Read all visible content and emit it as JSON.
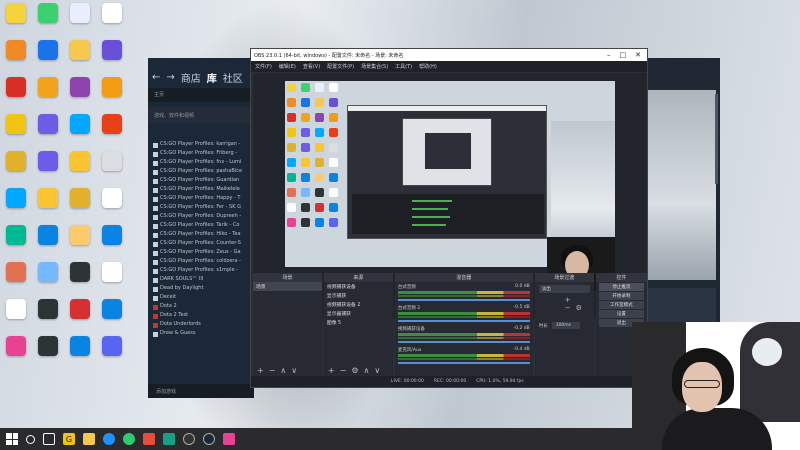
{
  "desktop_icons": [
    {
      "label": "",
      "color": "#f3d23b"
    },
    {
      "label": "",
      "color": "#3bd16f"
    },
    {
      "label": "",
      "color": "#e8f0ff"
    },
    {
      "label": "",
      "color": "#ffffff"
    },
    {
      "label": "",
      "color": "#f08a24"
    },
    {
      "label": "",
      "color": "#1a73e8"
    },
    {
      "label": "",
      "color": "#f6c94e"
    },
    {
      "label": "",
      "color": "#6a4fd8"
    },
    {
      "label": "",
      "color": "#d93025"
    },
    {
      "label": "",
      "color": "#f3a31b"
    },
    {
      "label": "",
      "color": "#8e44ad"
    },
    {
      "label": "",
      "color": "#f39c12"
    },
    {
      "label": "",
      "color": "#f1c40f"
    },
    {
      "label": "",
      "color": "#6c5ce7"
    },
    {
      "label": "",
      "color": "#00a8ff"
    },
    {
      "label": "",
      "color": "#e84118"
    },
    {
      "label": "",
      "color": "#e1b12c"
    },
    {
      "label": "",
      "color": "#6c5ce7"
    },
    {
      "label": "",
      "color": "#fbc531"
    },
    {
      "label": "",
      "color": "#dcdde1"
    },
    {
      "label": "",
      "color": "#00a8ff"
    },
    {
      "label": "",
      "color": "#fbc531"
    },
    {
      "label": "",
      "color": "#e1b12c"
    },
    {
      "label": "",
      "color": "#ffffff"
    },
    {
      "label": "",
      "color": "#00b894"
    },
    {
      "label": "",
      "color": "#0984e3"
    },
    {
      "label": "",
      "color": "#fdcb6e"
    },
    {
      "label": "",
      "color": "#0984e3"
    },
    {
      "label": "",
      "color": "#e17055"
    },
    {
      "label": "",
      "color": "#74b9ff"
    },
    {
      "label": "",
      "color": "#2d3436"
    },
    {
      "label": "",
      "color": "#ffffff"
    },
    {
      "label": "",
      "color": "#ffffff"
    },
    {
      "label": "",
      "color": "#2d3436"
    },
    {
      "label": "",
      "color": "#d63031"
    },
    {
      "label": "",
      "color": "#0984e3"
    },
    {
      "label": "",
      "color": "#e84393"
    },
    {
      "label": "",
      "color": "#2d3436"
    },
    {
      "label": "",
      "color": "#0984e3"
    },
    {
      "label": "",
      "color": "#5865f2"
    }
  ],
  "steam": {
    "nav_store": "商店",
    "nav_library": "库",
    "nav_community": "社区",
    "home": "主页",
    "filter": "游戏、软件和视频",
    "items": [
      "CS:GO Player Profiles: karrigan -",
      "CS:GO Player Profiles: Friberg -",
      "CS:GO Player Profiles: fnx - Lumi",
      "CS:GO Player Profiles: pashaBice",
      "CS:GO Player Profiles: Guardian",
      "CS:GO Player Profiles: Maikelele",
      "CS:GO Player Profiles: Happy - T",
      "CS:GO Player Profiles: Fer - SK G",
      "CS:GO Player Profiles: Dupreeh -",
      "CS:GO Player Profiles: Tarik - Co",
      "CS:GO Player Profiles: Hiko - Tea",
      "CS:GO Player Profiles: Counter-S",
      "CS:GO Player Profiles: Zeus - Ga",
      "CS:GO Player Profiles: coldzera -",
      "CS:GO Player Profiles: s1mple -",
      "DARK SOULS™ III",
      "Dead by Daylight",
      "Deceit",
      "Dota 2",
      "Dota 2 Test",
      "Dota Underlords",
      "Draw & Guess"
    ],
    "footer": "添加游戏"
  },
  "obs": {
    "title": "OBS 23.0.1 (64-bit, windows) - 配置文件: 未命名 - 场景: 未命名",
    "menu": [
      "文件(F)",
      "编辑(E)",
      "查看(V)",
      "配置文件(P)",
      "场景集合(S)",
      "工具(T)",
      "帮助(H)"
    ],
    "docks": {
      "scenes": {
        "title": "场景",
        "items": [
          "场景"
        ]
      },
      "sources": {
        "title": "来源",
        "items": [
          "视频捕获设备",
          "显示捕获",
          "视频捕获设备 2",
          "显示器捕获",
          "图像 5"
        ]
      },
      "mixer": {
        "title": "混音器",
        "tracks": [
          {
            "name": "台式音频",
            "db": "0.0 dB"
          },
          {
            "name": "台式音频 2",
            "db": "-0.5 dB"
          },
          {
            "name": "视频捕获设备",
            "db": "-0.2 dB"
          },
          {
            "name": "麦克风/Aux",
            "db": "-0.4 dB"
          }
        ]
      },
      "transitions": {
        "title": "场景过渡",
        "selected": "淡出",
        "duration_label": "时长",
        "duration": "300ms"
      },
      "controls": {
        "title": "控件",
        "buttons": [
          "停止推流",
          "开始录制",
          "工作室模式",
          "设置",
          "退出"
        ]
      }
    },
    "status": {
      "live": "LIVE: 00:00:00",
      "rec": "REC: 00:00:00",
      "cpu": "CPU: 1.0%, 59.94 fps"
    }
  }
}
